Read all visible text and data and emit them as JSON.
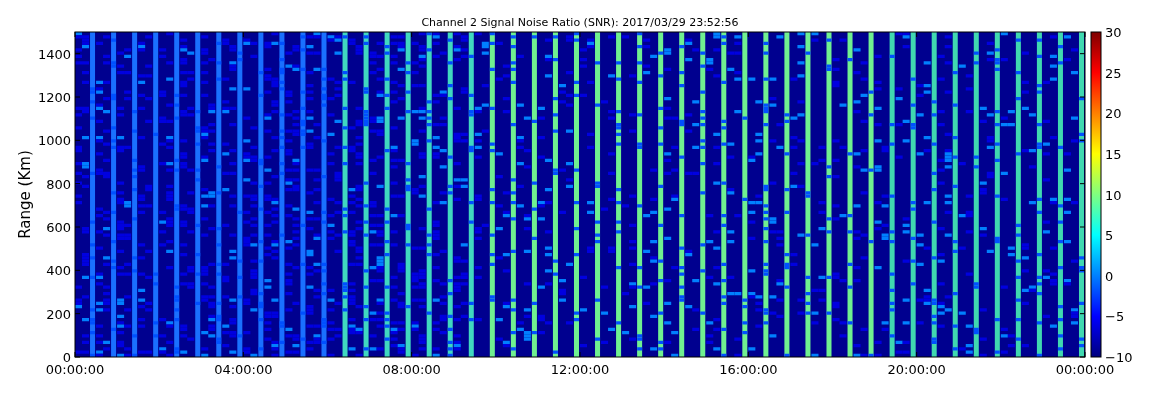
{
  "plot": {
    "title": "Channel 2 Signal Noise Ratio (SNR): 2017/03/29 23:52:56",
    "ylabel": "Range (Km)",
    "y_ticks": [
      "1400",
      "1200",
      "1000",
      "800",
      "600",
      "400",
      "200",
      "0"
    ],
    "x_ticks": [
      "00:00:00",
      "04:00:00",
      "08:00:00",
      "12:00:00",
      "16:00:00",
      "20:00:00",
      "00:00:00"
    ]
  },
  "colorbar": {
    "ticks": [
      "30",
      "25",
      "20",
      "15",
      "10",
      "5",
      "0",
      "−5",
      "−10"
    ]
  }
}
